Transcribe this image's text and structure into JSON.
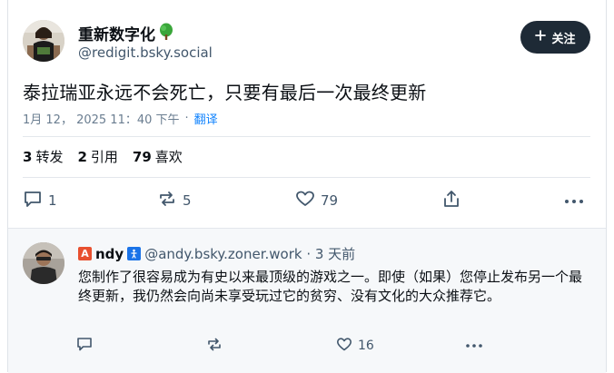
{
  "post": {
    "display_name": "重新数字化",
    "name_emoji": "tree",
    "handle": "@redigit.bsky.social",
    "follow_label": "关注",
    "text": "泰拉瑞亚永远不会死亡，只要有最后一次最终更新",
    "timestamp": "1月 12， 2025 11：40 下午",
    "dot": "·",
    "translate_label": "翻译",
    "stats": {
      "reposts_count": "3",
      "reposts_label": "转发",
      "quotes_count": "2",
      "quotes_label": "引用",
      "likes_count": "79",
      "likes_label": "喜欢"
    },
    "actions": {
      "reply_count": "1",
      "repost_count": "5",
      "like_count": "79"
    }
  },
  "reply": {
    "name_prefix": "A",
    "name": "ndy",
    "handle": "@andy.bsky.zoner.work · 3 天前",
    "text": "您制作了很容易成为有史以来最顶级的游戏之一。即使（如果）您停止发布另一个最终更新，我仍然会向尚未享受玩过它的贫穷、没有文化的大众推荐它。",
    "actions": {
      "reply_count": "",
      "repost_count": "",
      "like_count": "16"
    }
  },
  "colors": {
    "follow_bg": "#1e2a36",
    "link": "#1083fe",
    "muted": "#42576c",
    "reply_bg": "#f6f8fa"
  }
}
